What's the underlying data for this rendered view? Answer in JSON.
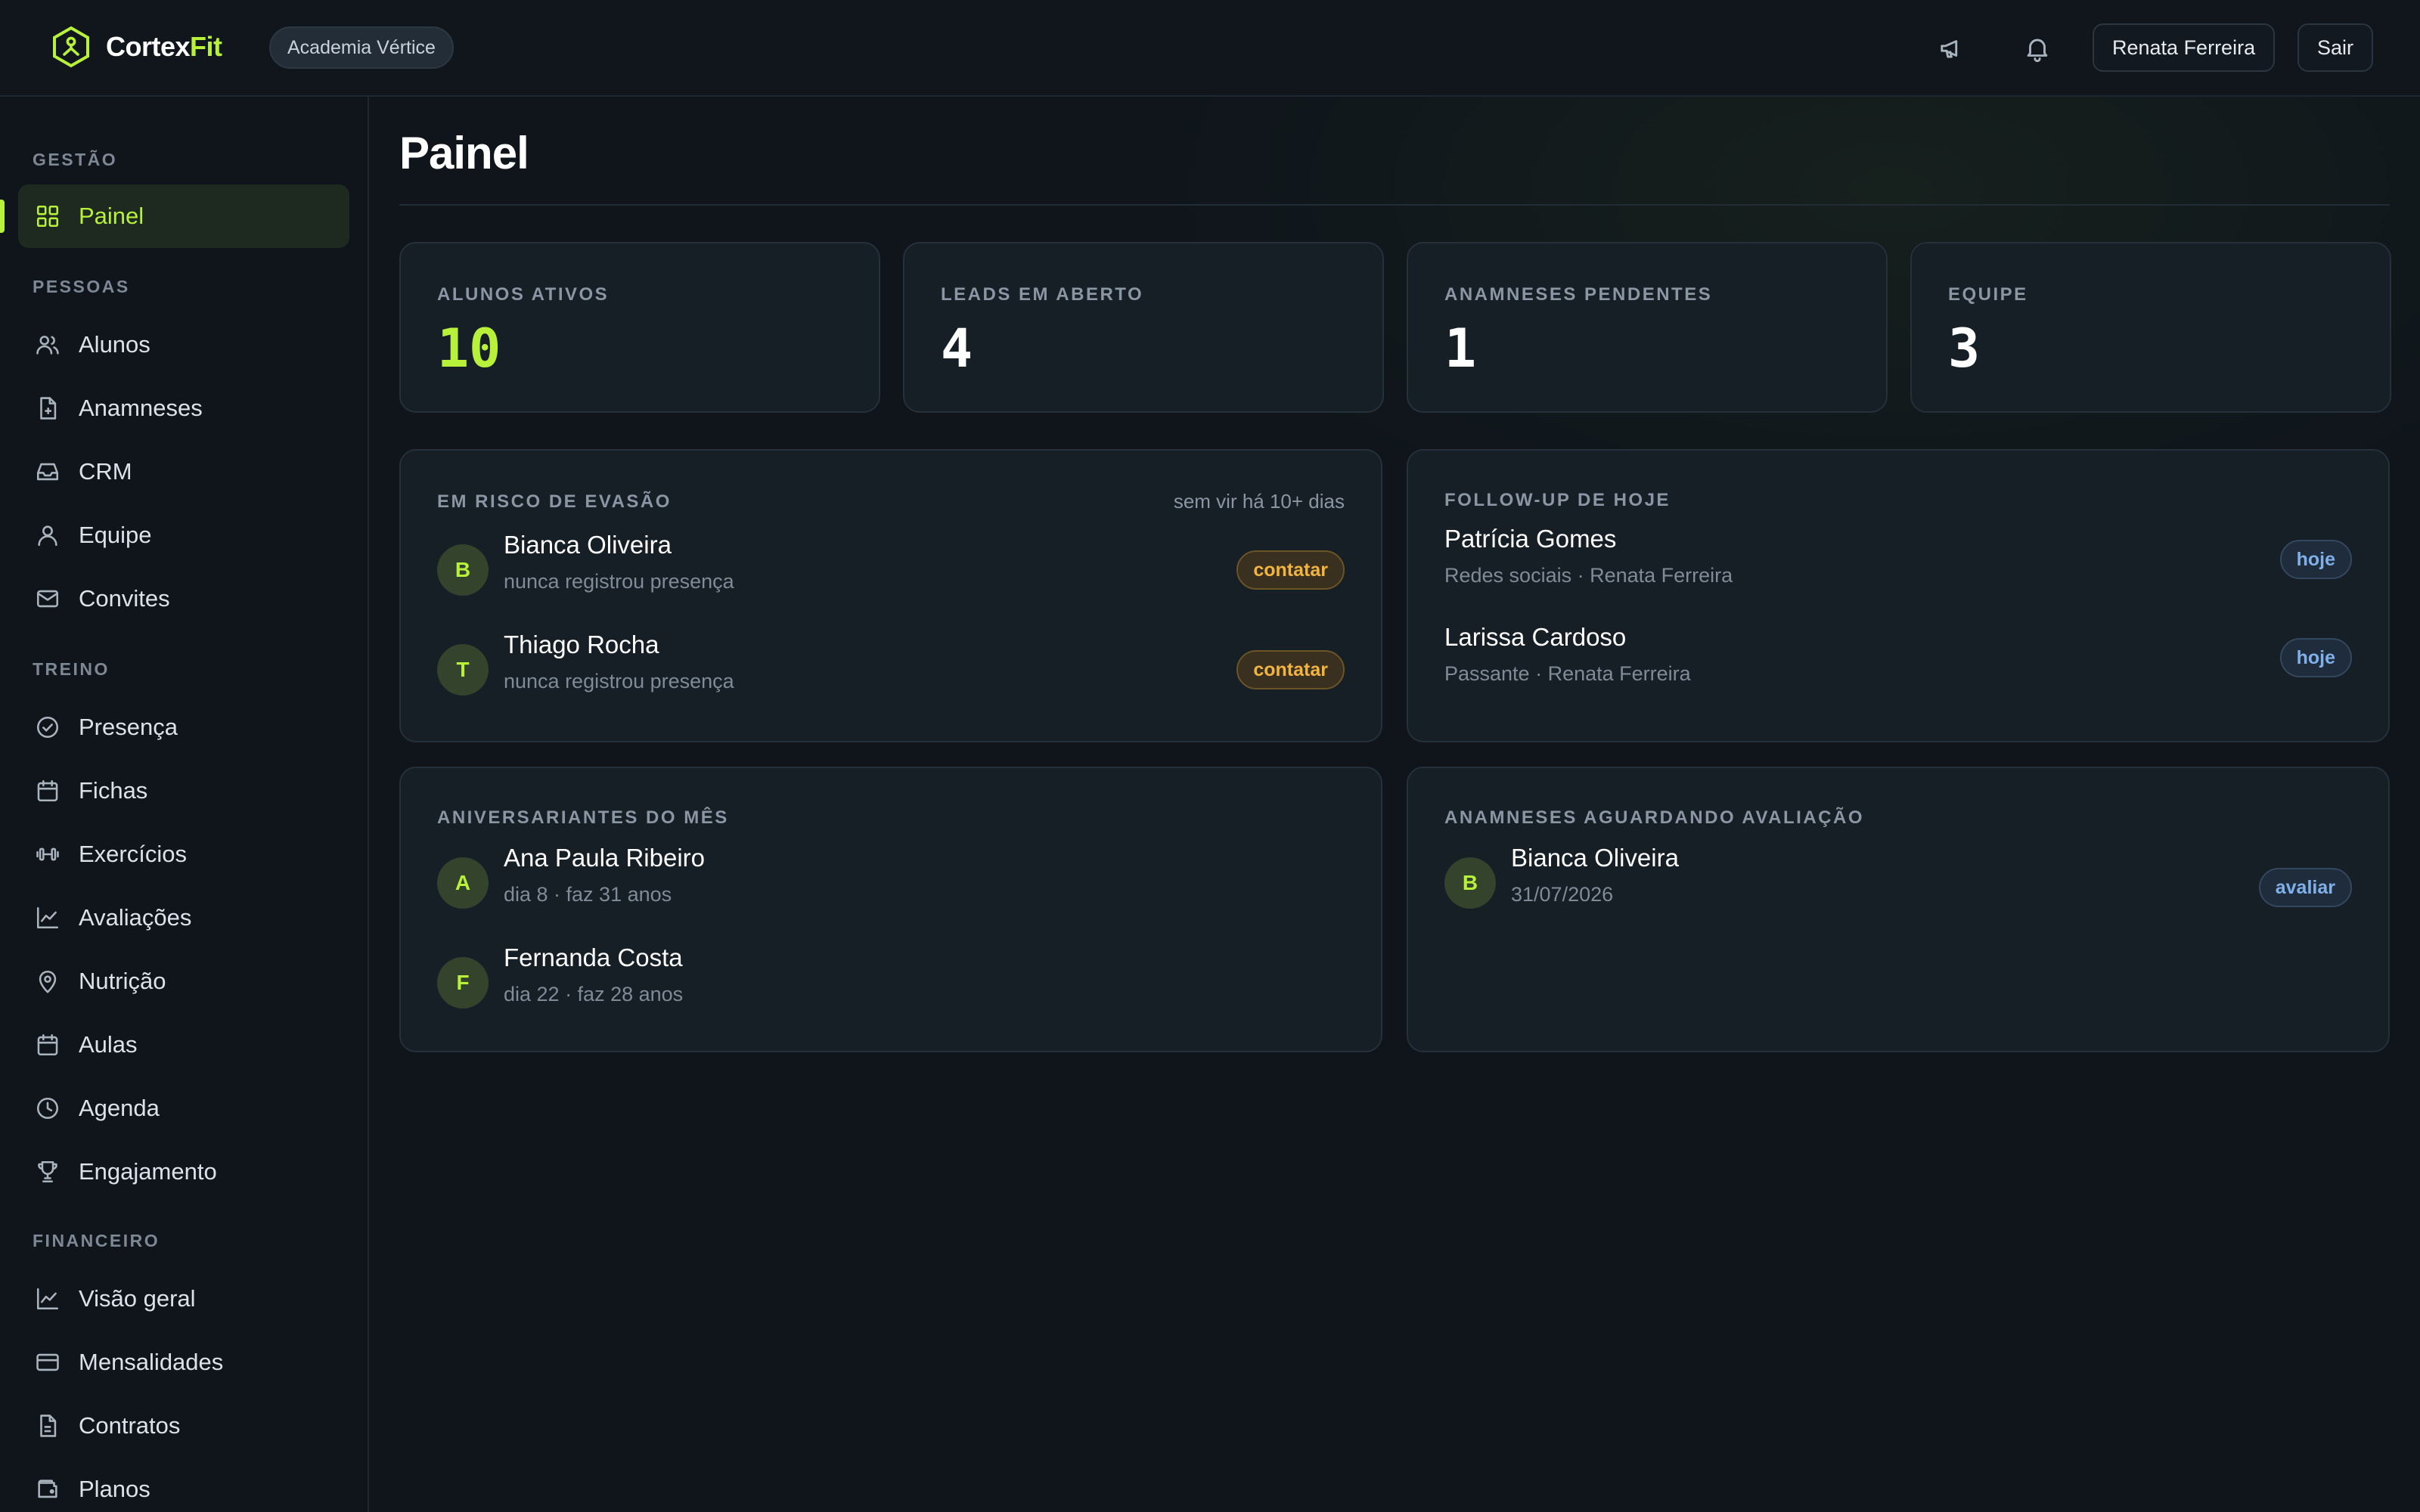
{
  "app": {
    "brand_part1": "Cortex",
    "brand_part2": "Fit",
    "org": "Academia Vértice",
    "user_button": "Renata Ferreira",
    "logout_button": "Sair",
    "accent": "#b7f13a"
  },
  "sidebar": {
    "sections": [
      {
        "label": "GESTÃO"
      },
      {
        "label": "PESSOAS"
      },
      {
        "label": "TREINO"
      },
      {
        "label": "FINANCEIRO"
      }
    ],
    "items": [
      {
        "label": "Painel",
        "icon": "dashboard-icon",
        "active": true
      },
      {
        "label": "Alunos",
        "icon": "users-icon"
      },
      {
        "label": "Anamneses",
        "icon": "file-plus-icon"
      },
      {
        "label": "CRM",
        "icon": "inbox-icon"
      },
      {
        "label": "Equipe",
        "icon": "user-icon"
      },
      {
        "label": "Convites",
        "icon": "mail-icon"
      },
      {
        "label": "Presença",
        "icon": "check-circle-icon"
      },
      {
        "label": "Fichas",
        "icon": "calendar-icon"
      },
      {
        "label": "Exercícios",
        "icon": "dumbbell-icon"
      },
      {
        "label": "Avaliações",
        "icon": "chart-line-icon"
      },
      {
        "label": "Nutrição",
        "icon": "map-pin-icon"
      },
      {
        "label": "Aulas",
        "icon": "calendar-icon"
      },
      {
        "label": "Agenda",
        "icon": "clock-icon"
      },
      {
        "label": "Engajamento",
        "icon": "trophy-icon"
      },
      {
        "label": "Visão geral",
        "icon": "chart-line-icon"
      },
      {
        "label": "Mensalidades",
        "icon": "credit-card-icon"
      },
      {
        "label": "Contratos",
        "icon": "file-text-icon"
      },
      {
        "label": "Planos",
        "icon": "wallet-icon"
      }
    ]
  },
  "page": {
    "title": "Painel"
  },
  "stats": [
    {
      "label": "ALUNOS ATIVOS",
      "value": "10"
    },
    {
      "label": "LEADS EM ABERTO",
      "value": "4"
    },
    {
      "label": "ANAMNESES PENDENTES",
      "value": "1"
    },
    {
      "label": "EQUIPE",
      "value": "3"
    }
  ],
  "risk": {
    "title": "EM RISCO DE EVASÃO",
    "meta": "sem vir há 10+ dias",
    "rows": [
      {
        "initial": "B",
        "name": "Bianca Oliveira",
        "sub": "nunca registrou presença",
        "action": "contatar"
      },
      {
        "initial": "T",
        "name": "Thiago Rocha",
        "sub": "nunca registrou presença",
        "action": "contatar"
      }
    ]
  },
  "followup": {
    "title": "FOLLOW-UP DE HOJE",
    "rows": [
      {
        "name": "Patrícia Gomes",
        "sub": "Redes sociais · Renata Ferreira",
        "tag": "hoje"
      },
      {
        "name": "Larissa Cardoso",
        "sub": "Passante · Renata Ferreira",
        "tag": "hoje"
      }
    ]
  },
  "birthdays": {
    "title": "ANIVERSARIANTES DO MÊS",
    "rows": [
      {
        "initial": "A",
        "name": "Ana Paula Ribeiro",
        "sub": "dia 8 · faz 31 anos"
      },
      {
        "initial": "F",
        "name": "Fernanda Costa",
        "sub": "dia 22 · faz 28 anos"
      }
    ]
  },
  "anamnesis": {
    "title": "ANAMNESES AGUARDANDO AVALIAÇÃO",
    "rows": [
      {
        "initial": "B",
        "name": "Bianca Oliveira",
        "sub": "31/07/2026",
        "action": "avaliar"
      }
    ]
  }
}
